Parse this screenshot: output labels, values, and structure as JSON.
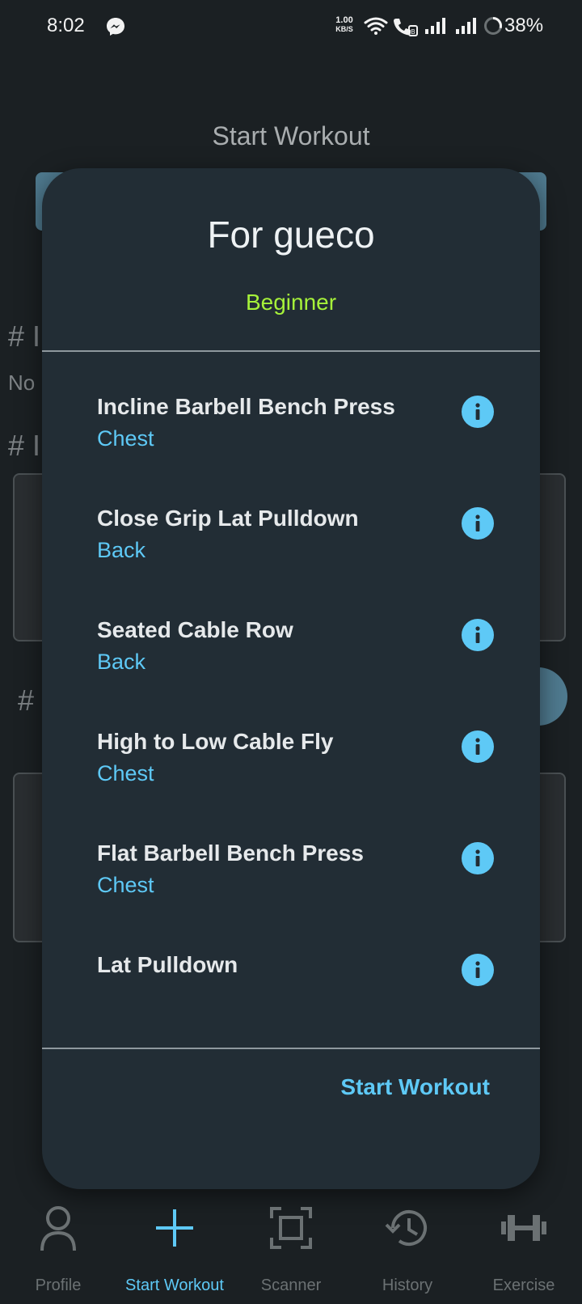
{
  "status_bar": {
    "time": "8:02",
    "net_speed_value": "1.00",
    "net_speed_unit": "KB/S",
    "battery": "38%"
  },
  "background": {
    "header_title": "Start Workout",
    "hash1": "# I",
    "no_text": "No",
    "hash2": "# I",
    "hash3": "#"
  },
  "dialog": {
    "title": "For gueco",
    "level": "Beginner",
    "exercises": [
      {
        "name": "Incline Barbell Bench Press",
        "muscle": "Chest"
      },
      {
        "name": "Close Grip Lat Pulldown",
        "muscle": "Back"
      },
      {
        "name": "Seated Cable Row",
        "muscle": "Back"
      },
      {
        "name": "High to Low Cable Fly",
        "muscle": "Chest"
      },
      {
        "name": "Flat Barbell Bench Press",
        "muscle": "Chest"
      },
      {
        "name": "Lat Pulldown",
        "muscle": ""
      }
    ],
    "start_button": "Start Workout"
  },
  "nav": {
    "items": [
      {
        "label": "Profile",
        "icon": "person-icon"
      },
      {
        "label": "Start Workout",
        "icon": "plus-icon"
      },
      {
        "label": "Scanner",
        "icon": "scan-frame-icon"
      },
      {
        "label": "History",
        "icon": "history-icon"
      },
      {
        "label": "Exercise",
        "icon": "dumbbell-icon"
      }
    ],
    "active_index": 1
  },
  "colors": {
    "accent": "#5ec9f6",
    "level": "#a6f23a",
    "dialog_bg": "#222d35",
    "screen_bg": "#1b2023"
  }
}
